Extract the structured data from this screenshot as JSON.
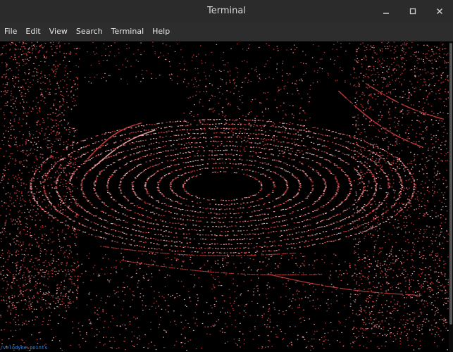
{
  "window": {
    "title": "Terminal",
    "minimize_icon": "minimize-icon",
    "maximize_icon": "maximize-icon",
    "close_icon": "close-icon"
  },
  "menu": {
    "items": [
      "File",
      "Edit",
      "View",
      "Search",
      "Terminal",
      "Help"
    ]
  },
  "terminal": {
    "bottom_text": "/velodyne_points",
    "point_color": "#c43a3a",
    "point_highlight": "#e8a0a0"
  }
}
